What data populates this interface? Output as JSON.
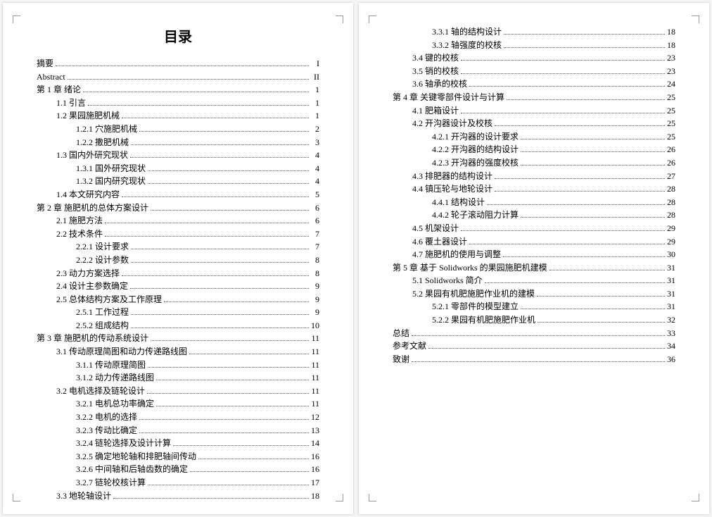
{
  "title": "目录",
  "left": [
    {
      "indent": 0,
      "text": "摘要",
      "page": "I"
    },
    {
      "indent": 0,
      "text": "Abstract",
      "page": "II"
    },
    {
      "indent": 0,
      "text": "第 1 章  绪论",
      "page": "1"
    },
    {
      "indent": 1,
      "text": "1.1 引言",
      "page": "1"
    },
    {
      "indent": 1,
      "text": "1.2 果园施肥机械",
      "page": "1"
    },
    {
      "indent": 2,
      "text": "1.2.1 穴施肥机械",
      "page": "2"
    },
    {
      "indent": 2,
      "text": "1.2.2 撒肥机械",
      "page": "3"
    },
    {
      "indent": 1,
      "text": "1.3 国内外研究现状",
      "page": "4"
    },
    {
      "indent": 2,
      "text": "1.3.1 国外研究现状",
      "page": "4"
    },
    {
      "indent": 2,
      "text": "1.3.2 国内研究现状",
      "page": "4"
    },
    {
      "indent": 1,
      "text": "1.4 本文研究内容",
      "page": "5"
    },
    {
      "indent": 0,
      "text": "第 2 章  施肥机的总体方案设计",
      "page": "6"
    },
    {
      "indent": 1,
      "text": "2.1 施肥方法",
      "page": "6"
    },
    {
      "indent": 1,
      "text": "2.2 技术条件",
      "page": "7"
    },
    {
      "indent": 2,
      "text": "2.2.1 设计要求",
      "page": "7"
    },
    {
      "indent": 2,
      "text": "2.2.2 设计参数",
      "page": "8"
    },
    {
      "indent": 1,
      "text": "2.3 动力方案选择",
      "page": "8"
    },
    {
      "indent": 1,
      "text": "2.4 设计主参数确定",
      "page": "9"
    },
    {
      "indent": 1,
      "text": "2.5 总体结构方案及工作原理",
      "page": "9"
    },
    {
      "indent": 2,
      "text": "2.5.1 工作过程",
      "page": "9"
    },
    {
      "indent": 2,
      "text": "2.5.2 组成结构",
      "page": "10"
    },
    {
      "indent": 0,
      "text": "第 3 章  施肥机的传动系统设计",
      "page": "11"
    },
    {
      "indent": 1,
      "text": "3.1 传动原理简图和动力传递路线图",
      "page": "11"
    },
    {
      "indent": 2,
      "text": "3.1.1 传动原理简图",
      "page": "11"
    },
    {
      "indent": 2,
      "text": "3.1.2 动力传递路线图",
      "page": "11"
    },
    {
      "indent": 1,
      "text": "3.2 电机选择及链轮设计",
      "page": "11"
    },
    {
      "indent": 2,
      "text": "3.2.1 电机总功率确定",
      "page": "11"
    },
    {
      "indent": 2,
      "text": "3.2.2 电机的选择",
      "page": "12"
    },
    {
      "indent": 2,
      "text": "3.2.3 传动比确定",
      "page": "13"
    },
    {
      "indent": 2,
      "text": "3.2.4 链轮选择及设计计算",
      "page": "14"
    },
    {
      "indent": 2,
      "text": "3.2.5 确定地轮轴和排肥轴间传动",
      "page": "16"
    },
    {
      "indent": 2,
      "text": "3.2.6 中间轴和后轴齿数的确定",
      "page": "16"
    },
    {
      "indent": 2,
      "text": "3.2.7 链轮校核计算",
      "page": "17"
    },
    {
      "indent": 1,
      "text": "3.3 地轮轴设计",
      "page": "18"
    }
  ],
  "right": [
    {
      "indent": 2,
      "text": "3.3.1 轴的结构设计",
      "page": "18"
    },
    {
      "indent": 2,
      "text": "3.3.2 轴强度的校核",
      "page": "18"
    },
    {
      "indent": 1,
      "text": "3.4 键的校核",
      "page": "23"
    },
    {
      "indent": 1,
      "text": "3.5 销的校核",
      "page": "23"
    },
    {
      "indent": 1,
      "text": "3.6 轴承的校核",
      "page": "24"
    },
    {
      "indent": 0,
      "text": "第 4 章  关键零部件设计与计算",
      "page": "25"
    },
    {
      "indent": 1,
      "text": "4.1 肥箱设计",
      "page": "25"
    },
    {
      "indent": 1,
      "text": "4.2 开沟器设计及校核",
      "page": "25"
    },
    {
      "indent": 2,
      "text": "4.2.1 开沟器的设计要求",
      "page": "25"
    },
    {
      "indent": 2,
      "text": "4.2.2 开沟器的结构设计",
      "page": "26"
    },
    {
      "indent": 2,
      "text": "4.2.3 开沟器的强度校核",
      "page": "26"
    },
    {
      "indent": 1,
      "text": "4.3 排肥器的结构设计",
      "page": "27"
    },
    {
      "indent": 1,
      "text": "4.4 镇压轮与地轮设计",
      "page": "28"
    },
    {
      "indent": 2,
      "text": "4.4.1 结构设计",
      "page": "28"
    },
    {
      "indent": 2,
      "text": "4.4.2 轮子滚动阻力计算",
      "page": "28"
    },
    {
      "indent": 1,
      "text": "4.5 机架设计",
      "page": "29"
    },
    {
      "indent": 1,
      "text": "4.6 覆土器设计",
      "page": "29"
    },
    {
      "indent": 1,
      "text": "4.7 施肥机的使用与调整",
      "page": "30"
    },
    {
      "indent": 0,
      "text": "第 5 章  基于 Solidworks 的果园施肥机建模",
      "page": "31"
    },
    {
      "indent": 1,
      "text": "5.1 Solidworks 简介",
      "page": "31"
    },
    {
      "indent": 1,
      "text": "5.2 果园有机肥施肥作业机的建模",
      "page": "31"
    },
    {
      "indent": 2,
      "text": "5.2.1 零部件的模型建立",
      "page": "31"
    },
    {
      "indent": 2,
      "text": "5.2.2 果园有机肥施肥作业机",
      "page": "32"
    },
    {
      "indent": 0,
      "text": "总结",
      "page": "33"
    },
    {
      "indent": 0,
      "text": "参考文献",
      "page": "34"
    },
    {
      "indent": 0,
      "text": "致谢",
      "page": "36"
    }
  ]
}
